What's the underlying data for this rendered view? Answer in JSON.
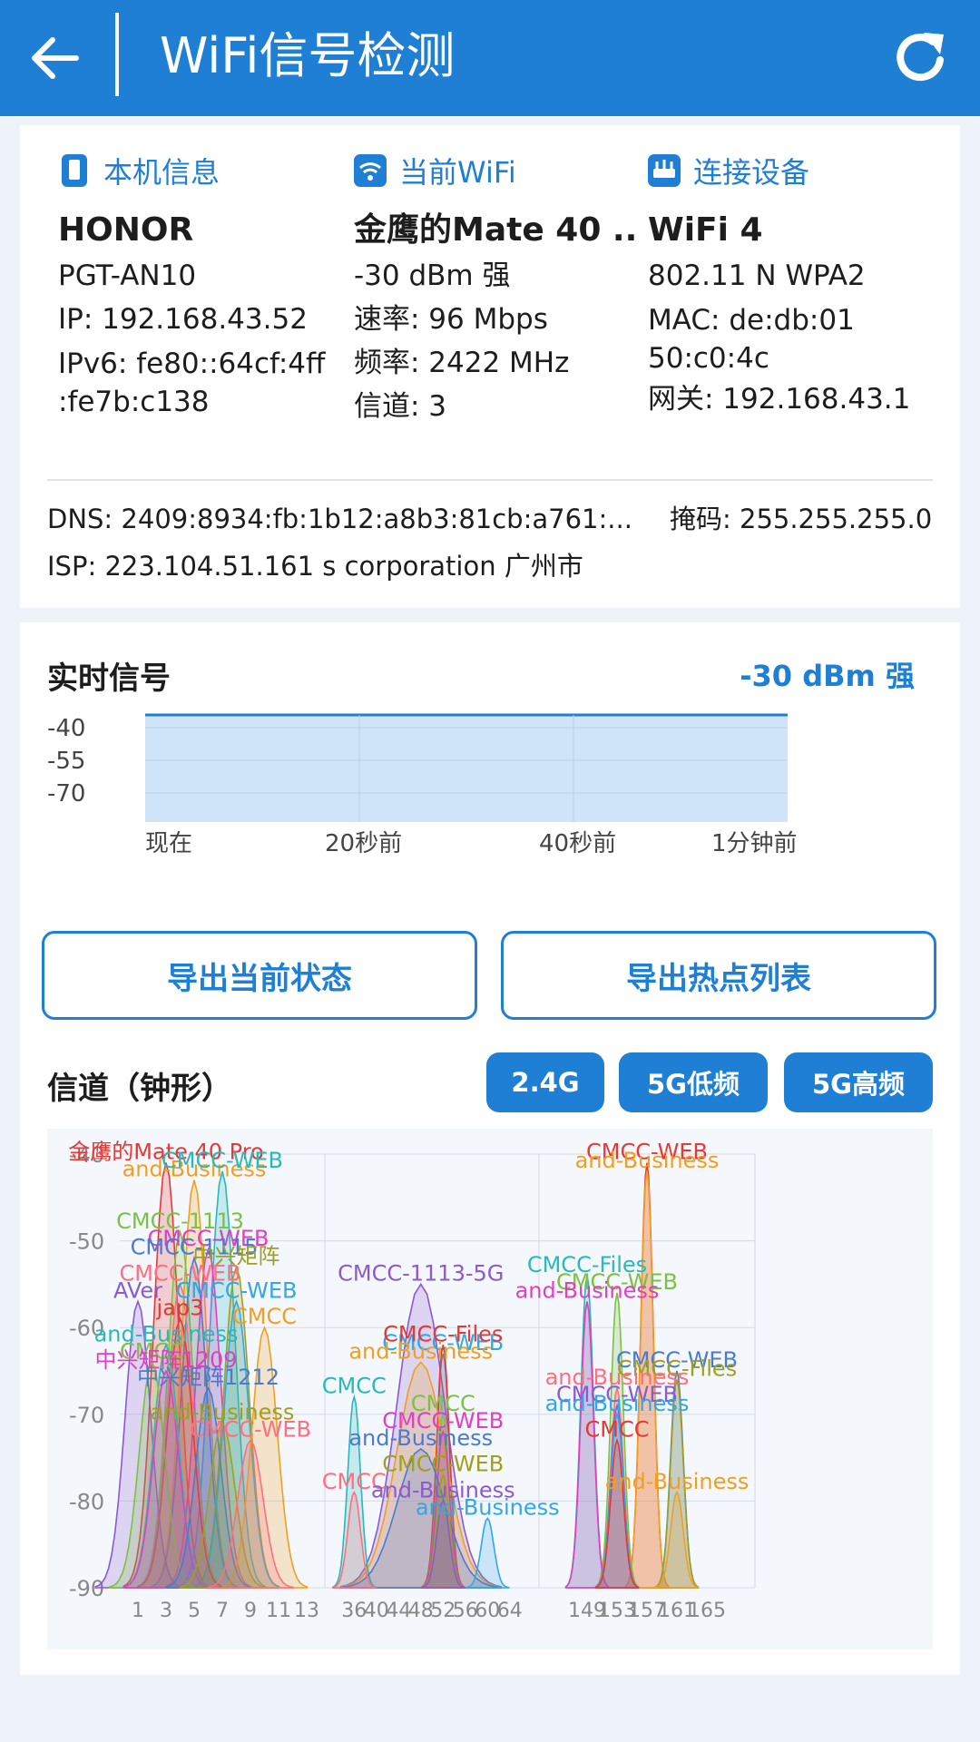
{
  "header": {
    "title": "WiFi信号检测",
    "back_icon": "arrow-left-icon",
    "refresh_icon": "refresh-icon"
  },
  "device": {
    "heading": "本机信息",
    "icon": "phone-icon",
    "brand": "HONOR",
    "model": "PGT-AN10",
    "ip": "IP: 192.168.43.52",
    "ipv6": "IPv6: fe80::64cf:4ff :fe7b:c138"
  },
  "wifi": {
    "heading": "当前WiFi",
    "icon": "wifi-icon",
    "ssid": "金鹰的Mate 40 ...",
    "signal": "-30 dBm  强",
    "speed": "速率: 96 Mbps",
    "freq": "频率: 2422 MHz",
    "channel": "信道: 3"
  },
  "conn": {
    "heading": "连接设备",
    "icon": "router-icon",
    "standard": "WiFi 4",
    "protocol": "802.11 N WPA2",
    "mac": "MAC: de:db:01 50:c0:4c",
    "gateway": "网关: 192.168.43.1"
  },
  "network": {
    "dns": "DNS: 2409:8934:fb:1b12:a8b3:81cb:a761:...",
    "mask": "掩码: 255.255.255.0",
    "isp": "ISP: 223.104.51.161 s corporation  广州市"
  },
  "realtime": {
    "title": "实时信号",
    "value": "-30 dBm  强",
    "y_ticks": [
      "-40",
      "-55",
      "-70"
    ],
    "x_ticks": [
      "现在",
      "20秒前",
      "40秒前",
      "1分钟前"
    ],
    "series_dbm": [
      -30,
      -30,
      -30,
      -30,
      -30,
      -30,
      -30
    ]
  },
  "actions": {
    "export_state": "导出当前状态",
    "export_list": "导出热点列表"
  },
  "channels": {
    "title": "信道（钟形）",
    "tabs": [
      "2.4G",
      "5G低频",
      "5G高频"
    ],
    "colors": [
      "#e53935",
      "#f0a020",
      "#2ab8b8",
      "#7cc142",
      "#e040c0",
      "#4a7bd0",
      "#a0a020",
      "#ff6f7f",
      "#8a5acf",
      "#30a8e8"
    ]
  },
  "chart_data": {
    "type": "area",
    "title": "",
    "ylabel": "",
    "ylim": [
      -90,
      -40
    ],
    "y_ticks": [
      -40,
      -50,
      -60,
      -70,
      -80,
      -90
    ],
    "x_ticks_24": [
      "1",
      "3",
      "5",
      "7",
      "9",
      "11",
      "13"
    ],
    "x_ticks_5low": [
      "36",
      "40",
      "44",
      "48",
      "52",
      "56",
      "60",
      "64"
    ],
    "x_ticks_5high": [
      "149",
      "153",
      "157",
      "161",
      "165"
    ],
    "series": [
      {
        "name": "金鹰的Mate 40 Pro",
        "band": "2.4",
        "channel": 3,
        "dbm": -41
      },
      {
        "name": "and-Business",
        "band": "2.4",
        "channel": 5,
        "dbm": -43
      },
      {
        "name": "CMCC-WEB",
        "band": "2.4",
        "channel": 7,
        "dbm": -42
      },
      {
        "name": "CMCC-1113",
        "band": "2.4",
        "channel": 4,
        "dbm": -49
      },
      {
        "name": "CMCC-WEB",
        "band": "2.4",
        "channel": 6,
        "dbm": -51
      },
      {
        "name": "CMCC-1115",
        "band": "2.4",
        "channel": 5,
        "dbm": -52
      },
      {
        "name": "中兴矩阵",
        "band": "2.4",
        "channel": 8,
        "dbm": -53
      },
      {
        "name": "CMCC-WEB",
        "band": "2.4",
        "channel": 4,
        "dbm": -55
      },
      {
        "name": "AVer",
        "band": "2.4",
        "channel": 1,
        "dbm": -57
      },
      {
        "name": "CMCC-WEB",
        "band": "2.4",
        "channel": 8,
        "dbm": -57
      },
      {
        "name": "jap3",
        "band": "2.4",
        "channel": 4,
        "dbm": -59
      },
      {
        "name": "CMCC",
        "band": "2.4",
        "channel": 10,
        "dbm": -60
      },
      {
        "name": "and-Business",
        "band": "2.4",
        "channel": 3,
        "dbm": -62
      },
      {
        "name": "CMCC",
        "band": "2.4",
        "channel": 2,
        "dbm": -64
      },
      {
        "name": "中兴矩阵1209",
        "band": "2.4",
        "channel": 3,
        "dbm": -65
      },
      {
        "name": "中兴矩阵1212",
        "band": "2.4",
        "channel": 6,
        "dbm": -67
      },
      {
        "name": "and-Business",
        "band": "2.4",
        "channel": 7,
        "dbm": -71
      },
      {
        "name": "CMCC-WEB",
        "band": "2.4",
        "channel": 9,
        "dbm": -73
      },
      {
        "name": "CMCC-1113-5G",
        "band": "5L",
        "channel": 48,
        "dbm": -55
      },
      {
        "name": "CMCC-WEB",
        "band": "5L",
        "channel": 52,
        "dbm": -63
      },
      {
        "name": "CMCC-Files",
        "band": "5L",
        "channel": 52,
        "dbm": -62
      },
      {
        "name": "and-Business",
        "band": "5L",
        "channel": 48,
        "dbm": -64
      },
      {
        "name": "CMCC",
        "band": "5L",
        "channel": 36,
        "dbm": -68
      },
      {
        "name": "CMCC",
        "band": "5L",
        "channel": 52,
        "dbm": -70
      },
      {
        "name": "CMCC-WEB",
        "band": "5L",
        "channel": 52,
        "dbm": -72
      },
      {
        "name": "and-Business",
        "band": "5L",
        "channel": 48,
        "dbm": -74
      },
      {
        "name": "CMCC-WEB",
        "band": "5L",
        "channel": 52,
        "dbm": -77
      },
      {
        "name": "CMCC",
        "band": "5L",
        "channel": 36,
        "dbm": -79
      },
      {
        "name": "and-Business",
        "band": "5L",
        "channel": 52,
        "dbm": -80
      },
      {
        "name": "and-Business",
        "band": "5L",
        "channel": 60,
        "dbm": -82
      },
      {
        "name": "CMCC-WEB",
        "band": "5H",
        "channel": 157,
        "dbm": -41
      },
      {
        "name": "and-Business",
        "band": "5H",
        "channel": 157,
        "dbm": -42
      },
      {
        "name": "CMCC-Files",
        "band": "5H",
        "channel": 149,
        "dbm": -54
      },
      {
        "name": "CMCC-WEB",
        "band": "5H",
        "channel": 153,
        "dbm": -56
      },
      {
        "name": "and-Business",
        "band": "5H",
        "channel": 149,
        "dbm": -57
      },
      {
        "name": "CMCC-WEB",
        "band": "5H",
        "channel": 161,
        "dbm": -65
      },
      {
        "name": "CMCC-Files",
        "band": "5H",
        "channel": 161,
        "dbm": -66
      },
      {
        "name": "and-Business",
        "band": "5H",
        "channel": 153,
        "dbm": -67
      },
      {
        "name": "CMCC-WEB",
        "band": "5H",
        "channel": 153,
        "dbm": -69
      },
      {
        "name": "and-Business",
        "band": "5H",
        "channel": 153,
        "dbm": -70
      },
      {
        "name": "CMCC",
        "band": "5H",
        "channel": 153,
        "dbm": -73
      },
      {
        "name": "and-Business",
        "band": "5H",
        "channel": 161,
        "dbm": -79
      }
    ]
  }
}
